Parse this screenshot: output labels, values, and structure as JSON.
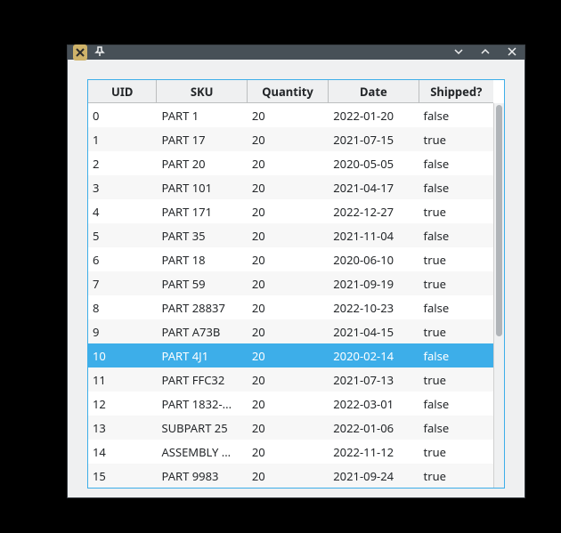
{
  "titlebar": {
    "close_icon": "close",
    "pin_icon": "pin",
    "min_icon": "chevron-down",
    "max_icon": "chevron-up",
    "close2_icon": "x"
  },
  "table": {
    "headers": [
      "UID",
      "SKU",
      "Quantity",
      "Date",
      "Shipped?"
    ],
    "selected_index": 10,
    "rows": [
      {
        "uid": "0",
        "sku": "PART 1",
        "qty": "20",
        "date": "2022-01-20",
        "shipped": "false"
      },
      {
        "uid": "1",
        "sku": "PART 17",
        "qty": "20",
        "date": "2021-07-15",
        "shipped": "true"
      },
      {
        "uid": "2",
        "sku": "PART 20",
        "qty": "20",
        "date": "2020-05-05",
        "shipped": "false"
      },
      {
        "uid": "3",
        "sku": "PART 101",
        "qty": "20",
        "date": "2021-04-17",
        "shipped": "false"
      },
      {
        "uid": "4",
        "sku": "PART 171",
        "qty": "20",
        "date": "2022-12-27",
        "shipped": "true"
      },
      {
        "uid": "5",
        "sku": "PART 35",
        "qty": "20",
        "date": "2021-11-04",
        "shipped": "false"
      },
      {
        "uid": "6",
        "sku": "PART 18",
        "qty": "20",
        "date": "2020-06-10",
        "shipped": "true"
      },
      {
        "uid": "7",
        "sku": "PART 59",
        "qty": "20",
        "date": "2021-09-19",
        "shipped": "true"
      },
      {
        "uid": "8",
        "sku": "PART 28837",
        "qty": "20",
        "date": "2022-10-23",
        "shipped": "false"
      },
      {
        "uid": "9",
        "sku": "PART A73B",
        "qty": "20",
        "date": "2021-04-15",
        "shipped": "true"
      },
      {
        "uid": "10",
        "sku": "PART 4J1",
        "qty": "20",
        "date": "2020-02-14",
        "shipped": "false"
      },
      {
        "uid": "11",
        "sku": "PART FFC32",
        "qty": "20",
        "date": "2021-07-13",
        "shipped": "true"
      },
      {
        "uid": "12",
        "sku": "PART 1832-...",
        "qty": "20",
        "date": "2022-03-01",
        "shipped": "false"
      },
      {
        "uid": "13",
        "sku": "SUBPART 25",
        "qty": "20",
        "date": "2022-01-06",
        "shipped": "false"
      },
      {
        "uid": "14",
        "sku": "ASSEMBLY ...",
        "qty": "20",
        "date": "2022-11-12",
        "shipped": "true"
      },
      {
        "uid": "15",
        "sku": "PART 9983",
        "qty": "20",
        "date": "2021-09-24",
        "shipped": "true"
      }
    ]
  },
  "colors": {
    "accent": "#3daee9",
    "titlebar": "#475057",
    "panel": "#eff0f1"
  }
}
